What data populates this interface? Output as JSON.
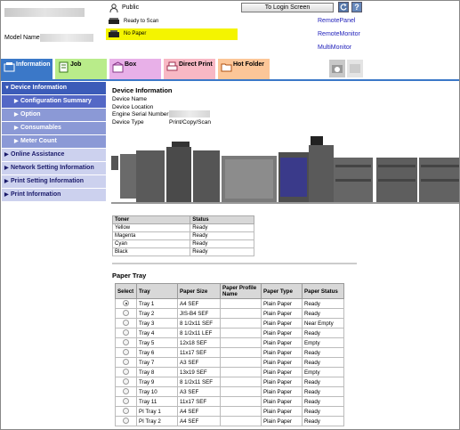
{
  "header": {
    "model_label": "Model Name",
    "user_label": "Public",
    "login_button": "To Login Screen",
    "status_ready": "Ready to Scan",
    "status_paper": "No Paper",
    "status_paper_color": "#f4f400",
    "links": [
      "RemotePanel",
      "RemoteMonitor",
      "MultiMonitor"
    ]
  },
  "tabs": [
    {
      "label": "Information",
      "icon": "info-icon",
      "color": "#3b78c8"
    },
    {
      "label": "Job",
      "icon": "job-icon",
      "color": "#b9ec8a"
    },
    {
      "label": "Box",
      "icon": "box-icon",
      "color": "#e8b0e8"
    },
    {
      "label": "Direct Print",
      "icon": "direct-print-icon",
      "color": "#f8b8c4"
    },
    {
      "label": "Hot Folder",
      "icon": "hot-folder-icon",
      "color": "#fcc698"
    }
  ],
  "sidebar": {
    "items": [
      {
        "label": "Device Information"
      },
      {
        "label": "Configuration Summary"
      },
      {
        "label": "Option"
      },
      {
        "label": "Consumables"
      },
      {
        "label": "Meter Count"
      },
      {
        "label": "Online Assistance"
      },
      {
        "label": "Network Setting Information"
      },
      {
        "label": "Print Setting Information"
      },
      {
        "label": "Print Information"
      }
    ]
  },
  "device": {
    "title": "Device Information",
    "labels": [
      "Device Name",
      "Device Location",
      "Engine Serial Number",
      "Device Type"
    ],
    "device_type_value": "Print/Copy/Scan"
  },
  "toner": {
    "headers": [
      "Toner",
      "Status"
    ],
    "rows": [
      [
        "Yellow",
        "Ready"
      ],
      [
        "Magenta",
        "Ready"
      ],
      [
        "Cyan",
        "Ready"
      ],
      [
        "Black",
        "Ready"
      ]
    ]
  },
  "paper_tray": {
    "title": "Paper Tray",
    "headers": [
      "Select",
      "Tray",
      "Paper Size",
      "Paper Profile Name",
      "Paper Type",
      "Paper Status"
    ],
    "rows": [
      {
        "tray": "Tray 1",
        "size": "A4 SEF",
        "profile": "",
        "type": "Plain Paper",
        "status": "Ready",
        "selected": true
      },
      {
        "tray": "Tray 2",
        "size": "JIS-B4 SEF",
        "profile": "",
        "type": "Plain Paper",
        "status": "Ready",
        "selected": false
      },
      {
        "tray": "Tray 3",
        "size": "8 1/2x11 SEF",
        "profile": "",
        "type": "Plain Paper",
        "status": "Near Empty",
        "selected": false
      },
      {
        "tray": "Tray 4",
        "size": "8 1/2x11 LEF",
        "profile": "",
        "type": "Plain Paper",
        "status": "Ready",
        "selected": false
      },
      {
        "tray": "Tray 5",
        "size": "12x18 SEF",
        "profile": "",
        "type": "Plain Paper",
        "status": "Empty",
        "selected": false
      },
      {
        "tray": "Tray 6",
        "size": "11x17 SEF",
        "profile": "",
        "type": "Plain Paper",
        "status": "Ready",
        "selected": false
      },
      {
        "tray": "Tray 7",
        "size": "A3 SEF",
        "profile": "",
        "type": "Plain Paper",
        "status": "Ready",
        "selected": false
      },
      {
        "tray": "Tray 8",
        "size": "13x19 SEF",
        "profile": "",
        "type": "Plain Paper",
        "status": "Empty",
        "selected": false
      },
      {
        "tray": "Tray 9",
        "size": "8 1/2x11 SEF",
        "profile": "",
        "type": "Plain Paper",
        "status": "Ready",
        "selected": false
      },
      {
        "tray": "Tray 10",
        "size": "A3 SEF",
        "profile": "",
        "type": "Plain Paper",
        "status": "Ready",
        "selected": false
      },
      {
        "tray": "Tray 11",
        "size": "11x17 SEF",
        "profile": "",
        "type": "Plain Paper",
        "status": "Ready",
        "selected": false
      },
      {
        "tray": "PI Tray 1",
        "size": "A4 SEF",
        "profile": "",
        "type": "Plain Paper",
        "status": "Ready",
        "selected": false
      },
      {
        "tray": "PI Tray 2",
        "size": "A4 SEF",
        "profile": "",
        "type": "Plain Paper",
        "status": "Ready",
        "selected": false
      }
    ]
  }
}
